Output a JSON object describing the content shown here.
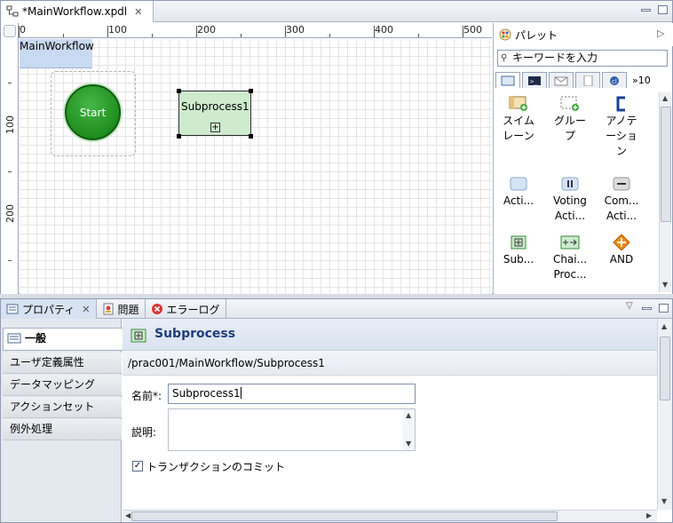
{
  "editor": {
    "tab_title": "*MainWorkflow.xpdl",
    "ruler_top_labels": [
      "0",
      "100",
      "200",
      "300",
      "400",
      "500"
    ],
    "ruler_left_labels": [
      "100",
      "200"
    ],
    "pool_name": "MainWorkflow",
    "start_label": "Start",
    "subprocess_label": "Subprocess1"
  },
  "palette": {
    "title": "パレット",
    "search_placeholder": "キーワードを入力",
    "tab_overflow": "»10",
    "items": [
      {
        "label": "スイム\nレーン",
        "icon": "swimlane-icon"
      },
      {
        "label": "グルー\nプ",
        "icon": "group-icon"
      },
      {
        "label": "アノテ\nーショ\nン",
        "icon": "annotation-icon"
      },
      {
        "label": "Acti...",
        "icon": "activity-icon"
      },
      {
        "label": "Voting\nActi...",
        "icon": "voting-activity-icon"
      },
      {
        "label": "Com...\nActi...",
        "icon": "compensation-activity-icon"
      },
      {
        "label": "Sub...",
        "icon": "subprocess-icon"
      },
      {
        "label": "Chai...\nProc...",
        "icon": "chained-process-icon"
      },
      {
        "label": "AND",
        "icon": "and-gateway-icon"
      }
    ]
  },
  "properties": {
    "tabs": [
      {
        "label": "プロパティ"
      },
      {
        "label": "問題"
      },
      {
        "label": "エラーログ"
      }
    ],
    "side_tabs": [
      "一般",
      "ユーザ定義属性",
      "データマッピング",
      "アクションセット",
      "例外処理"
    ],
    "header_title": "Subprocess",
    "path": "/prac001/MainWorkflow/Subprocess1",
    "name_label": "名前*:",
    "name_value": "Subprocess1",
    "description_label": "説明:",
    "description_value": "",
    "commit_label": "トランザクションのコミット",
    "commit_checked": true
  }
}
